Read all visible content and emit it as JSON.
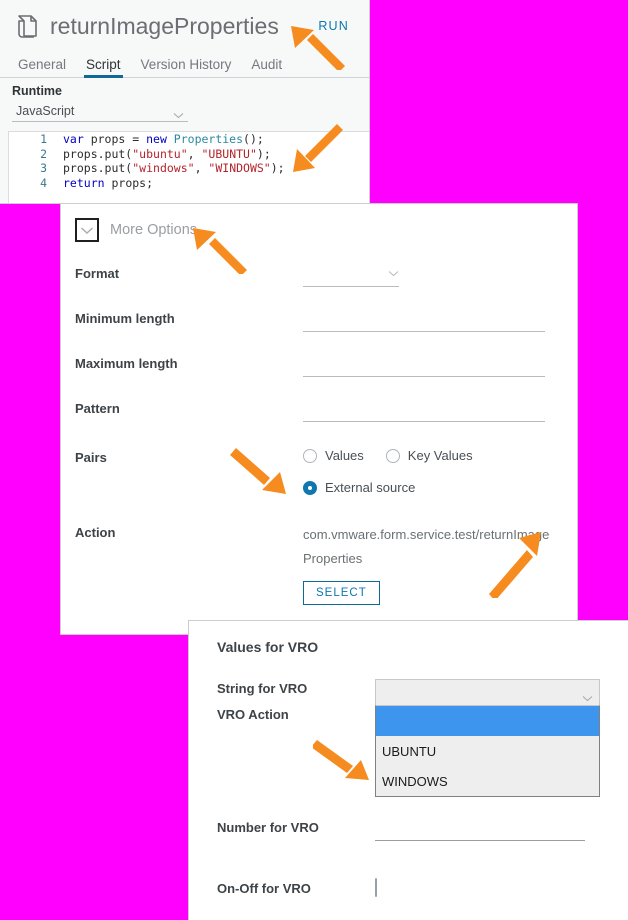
{
  "colors": {
    "background": "#FF00FF",
    "accent": "#0d78ad",
    "tab_underline": "#0d6a94",
    "radio_selected": "#1177af",
    "dropdown_highlight": "#3d95ee",
    "arrow": "#F68B1F"
  },
  "script_panel": {
    "icon": "script-document-icon",
    "title": "returnImageProperties",
    "run_label": "RUN",
    "tabs": [
      {
        "label": "General",
        "active": false
      },
      {
        "label": "Script",
        "active": true
      },
      {
        "label": "Version History",
        "active": false
      },
      {
        "label": "Audit",
        "active": false
      }
    ],
    "runtime_label": "Runtime",
    "runtime_value": "JavaScript",
    "runtime_caret": "chevron-down-icon",
    "code_lines": [
      {
        "num": "1",
        "tokens": [
          {
            "t": "var ",
            "c": "kw"
          },
          {
            "t": "props = ",
            "c": ""
          },
          {
            "t": "new ",
            "c": "kw"
          },
          {
            "t": "Properties",
            "c": "ty"
          },
          {
            "t": "();",
            "c": ""
          }
        ]
      },
      {
        "num": "2",
        "tokens": [
          {
            "t": "props.put(",
            "c": ""
          },
          {
            "t": "\"ubuntu\"",
            "c": "str"
          },
          {
            "t": ", ",
            "c": ""
          },
          {
            "t": "\"UBUNTU\"",
            "c": "str"
          },
          {
            "t": ");",
            "c": ""
          }
        ]
      },
      {
        "num": "3",
        "tokens": [
          {
            "t": "props.put(",
            "c": ""
          },
          {
            "t": "\"windows\"",
            "c": "str"
          },
          {
            "t": ", ",
            "c": ""
          },
          {
            "t": "\"WINDOWS\"",
            "c": "str"
          },
          {
            "t": ");",
            "c": ""
          }
        ]
      },
      {
        "num": "4",
        "tokens": [
          {
            "t": "return ",
            "c": "kw"
          },
          {
            "t": "props;",
            "c": ""
          }
        ]
      }
    ]
  },
  "form_panel": {
    "more_options_label": "More Options",
    "more_options_caret": "chevron-down-icon",
    "rows": {
      "format_label": "Format",
      "format_value": "",
      "format_caret": "chevron-down-icon",
      "minimum_length_label": "Minimum length",
      "minimum_length_value": "",
      "maximum_length_label": "Maximum length",
      "maximum_length_value": "",
      "pattern_label": "Pattern",
      "pattern_value": "",
      "pairs_label": "Pairs",
      "action_label": "Action"
    },
    "pairs_options": [
      {
        "label": "Values",
        "selected": false
      },
      {
        "label": "Key Values",
        "selected": false
      },
      {
        "label": "External source",
        "selected": true
      }
    ],
    "action_value": "com.vmware.form.service.test/returnImageProperties",
    "action_value_line1": "com.vmware.form.service.test/returnImage",
    "action_value_line2": "Properties",
    "select_button_label": "SELECT"
  },
  "vro_panel": {
    "title": "Values for VRO",
    "string_label": "String for VRO",
    "string_value": "",
    "string_caret": "chevron-down-icon",
    "dropdown_options": [
      "",
      "UBUNTU",
      "WINDOWS"
    ],
    "dropdown_selected_index": 0,
    "vro_action_label": "VRO Action",
    "number_label": "Number for VRO",
    "number_value": "",
    "onoff_label": "On-Off for VRO",
    "onoff_checked": false
  },
  "annotations": {
    "arrows": [
      {
        "name": "arrow-to-title",
        "points_at": "returnImageProperties title"
      },
      {
        "name": "arrow-to-code-line-2",
        "points_at": "props.put(\"ubuntu\", \"UBUNTU\");"
      },
      {
        "name": "arrow-to-more-options",
        "points_at": "More Options"
      },
      {
        "name": "arrow-to-external-source",
        "points_at": "External source radio"
      },
      {
        "name": "arrow-to-action-value",
        "points_at": "Action value"
      },
      {
        "name": "arrow-to-dropdown-options",
        "points_at": "UBUNTU / WINDOWS options"
      }
    ]
  }
}
